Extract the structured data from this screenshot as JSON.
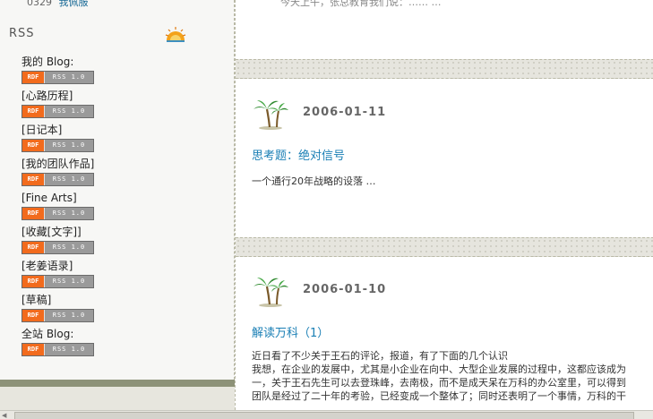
{
  "sidebar": {
    "top_date": "0329",
    "top_link": "我佩服",
    "rss_heading": "RSS",
    "rss_logo_icon": "sunrise-logo-icon",
    "badge": {
      "rdf": "RDF",
      "version": "RSS 1.0"
    },
    "feeds": [
      {
        "label": "我的 Blog:"
      },
      {
        "label": "[心路历程]"
      },
      {
        "label": "[日记本]"
      },
      {
        "label": "[我的团队作品]"
      },
      {
        "label": "[Fine Arts]"
      },
      {
        "label": "[收藏[文字]]"
      },
      {
        "label": "[老姜语录]"
      },
      {
        "label": "[草稿]"
      },
      {
        "label": "全站 Blog:"
      }
    ]
  },
  "main": {
    "top_text": "今天上午，张总教育我们说：…… …",
    "posts": [
      {
        "date": "2006-01-11",
        "title": "思考题：绝对信号",
        "excerpt": "一个通行20年战略的设落  …",
        "icon": "palm-tree-icon"
      },
      {
        "date": "2006-01-10",
        "title": "解读万科（1）",
        "icon": "palm-tree-icon",
        "body_lines": [
          "近日看了不少关于王石的评论，报道，有了下面的几个认识",
          "我想，在企业的发展中，尤其是小企业在向中、大型企业发展的过程中，这都应该成为",
          "一，关于王石先生可以去登珠峰，去南极，而不是成天呆在万科的办公室里，可以得到",
          "团队是经过了二十年的考验，已经变成一个整体了；同时还表明了一个事情，万科的干"
        ]
      }
    ]
  },
  "colors": {
    "title_link": "#1a7fb5",
    "rdf_badge": "#f26b1d",
    "sidebar_footer": "#8d9278"
  }
}
